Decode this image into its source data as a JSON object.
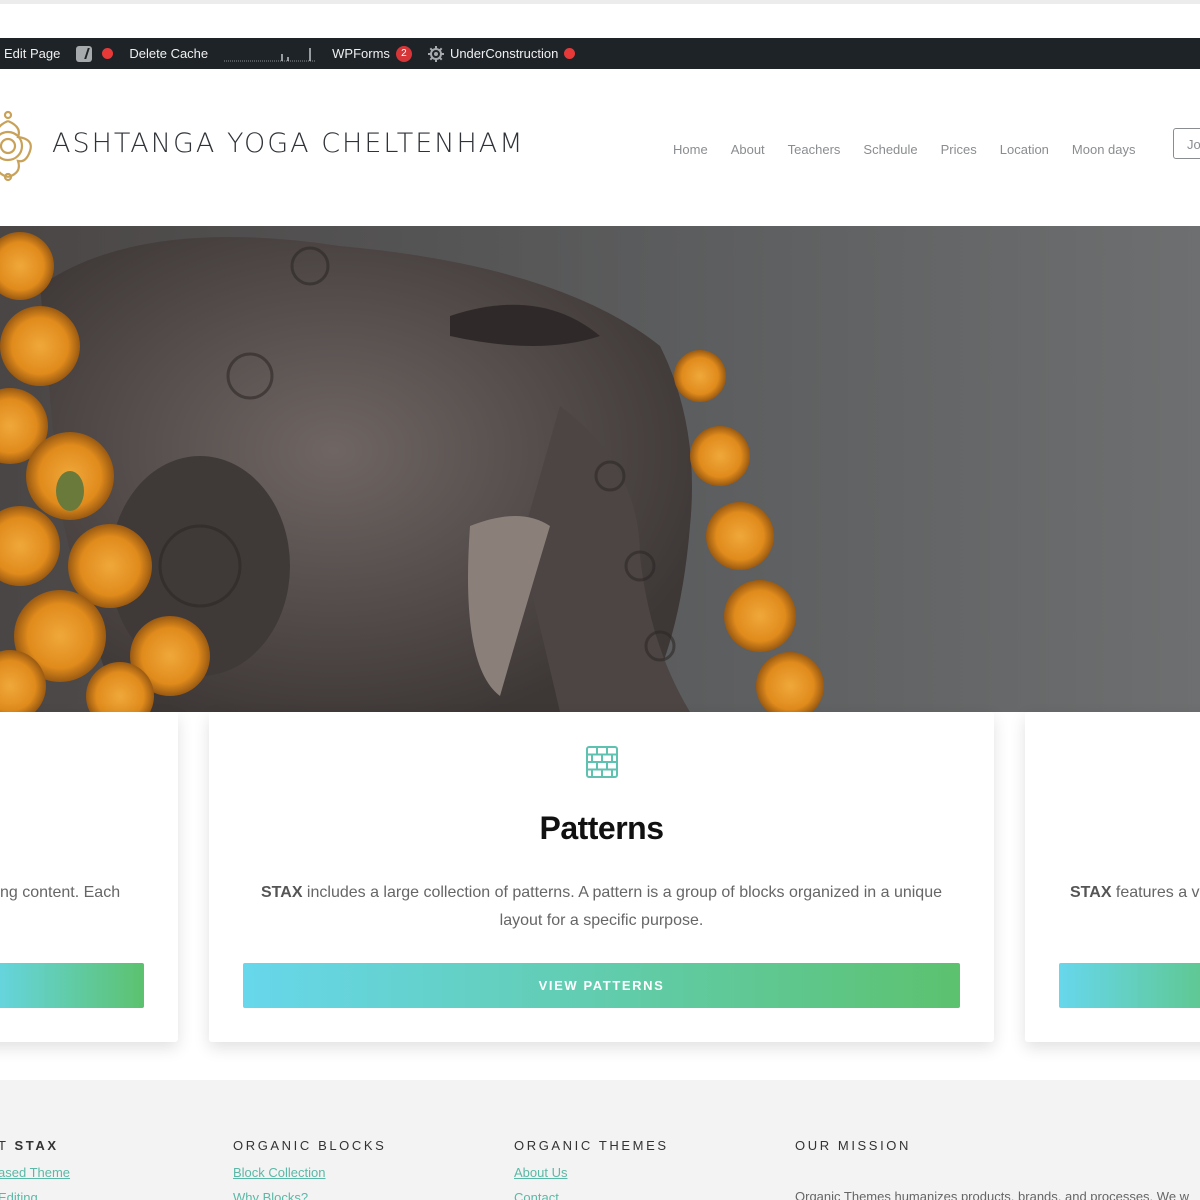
{
  "admin_bar": {
    "edit_page": "Edit Page",
    "delete_cache": "Delete Cache",
    "wpforms": "WPForms",
    "wpforms_count": "2",
    "under_construction": "UnderConstruction",
    "icons": [
      "yoast-icon",
      "status-dot-icon",
      "stats-sparkline-icon",
      "gear-icon"
    ]
  },
  "header": {
    "site_title": "ASHTANGA YOGA CHELTENHAM",
    "logo": "mandala-logo-icon",
    "nav": [
      "Home",
      "About",
      "Teachers",
      "Schedule",
      "Prices",
      "Location",
      "Moon days"
    ],
    "nav_button": "Jo"
  },
  "cards": {
    "left": {
      "text": "ng content. Each"
    },
    "middle": {
      "icon": "brick-wall-icon",
      "title": "Patterns",
      "desc_bold": "STAX",
      "desc_rest": " includes a large collection of patterns. A pattern is a group of blocks organized in a unique layout for a specific purpose.",
      "button": "VIEW PATTERNS"
    },
    "right": {
      "text_bold": "STAX",
      "text_rest": " features a v"
    }
  },
  "footer": {
    "col1": {
      "heading_prefix": "T ",
      "heading_bold": "STAX",
      "links": [
        "ased Theme",
        "Editing"
      ]
    },
    "col2": {
      "heading": "ORGANIC BLOCKS",
      "links": [
        "Block Collection",
        "Why Blocks?"
      ]
    },
    "col3": {
      "heading": "ORGANIC THEMES",
      "links": [
        "About Us",
        "Contact"
      ]
    },
    "col4": {
      "heading": "OUR MISSION",
      "text": "Organic Themes humanizes products, brands, and processes. We w"
    }
  },
  "colors": {
    "admin_bar": "#1d2327",
    "accent_gradient_start": "#67d7ec",
    "accent_gradient_end": "#5cc26f",
    "logo_gold": "#c9a25a",
    "link": "#5cb8a6",
    "badge": "#d63638"
  }
}
